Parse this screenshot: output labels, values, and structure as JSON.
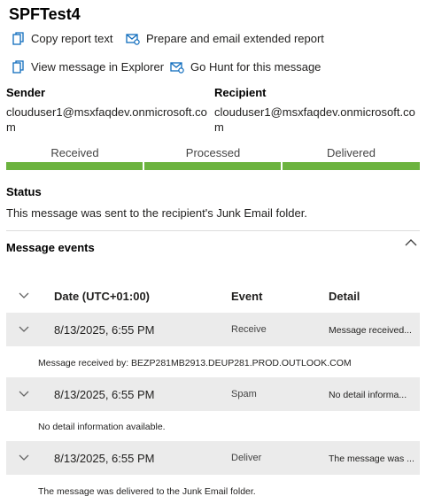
{
  "title": "SPFTest4",
  "actions": {
    "copy_report": "Copy report text",
    "prepare_email": "Prepare and email extended report",
    "view_explorer": "View message in Explorer",
    "go_hunt": "Go Hunt for this message"
  },
  "sender": {
    "label": "Sender",
    "address": "clouduser1@msxfaqdev.onmicrosoft.com"
  },
  "recipient": {
    "label": "Recipient",
    "address": "clouduser1@msxfaqdev.onmicrosoft.com"
  },
  "stages": {
    "received": "Received",
    "processed": "Processed",
    "delivered": "Delivered",
    "progress_fraction": 1.0,
    "bar_color": "#6cb33f"
  },
  "status": {
    "label": "Status",
    "text": "This message was sent to the recipient's Junk Email folder."
  },
  "events": {
    "label": "Message events",
    "columns": {
      "date": "Date (UTC+01:00)",
      "event": "Event",
      "detail": "Detail"
    },
    "rows": [
      {
        "date": "8/13/2025, 6:55 PM",
        "event": "Receive",
        "detail": "Message received...",
        "expanded": "Message received by: BEZP281MB2913.DEUP281.PROD.OUTLOOK.COM"
      },
      {
        "date": "8/13/2025, 6:55 PM",
        "event": "Spam",
        "detail": "No detail informa...",
        "expanded": "No detail information available."
      },
      {
        "date": "8/13/2025, 6:55 PM",
        "event": "Deliver",
        "detail": "The message was ...",
        "expanded": "The message was delivered to the Junk Email folder."
      }
    ]
  }
}
